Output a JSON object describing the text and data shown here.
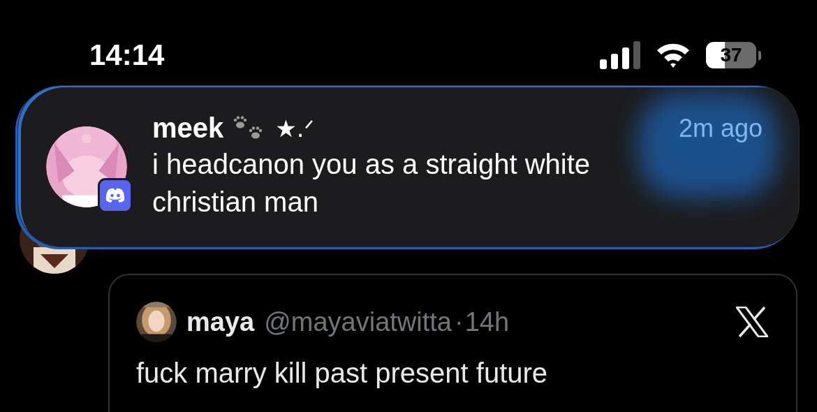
{
  "status_bar": {
    "time": "14:14",
    "battery": "37"
  },
  "notification": {
    "sender": "meek",
    "sender_decoration": "★.ᐟ",
    "time": "2m ago",
    "message": "i headcanon you as a straight white christian man"
  },
  "tweet": {
    "name": "maya",
    "handle": "@mayaviatwitta",
    "separator": "·",
    "time": "14h",
    "text": "fuck marry kill past present future"
  }
}
